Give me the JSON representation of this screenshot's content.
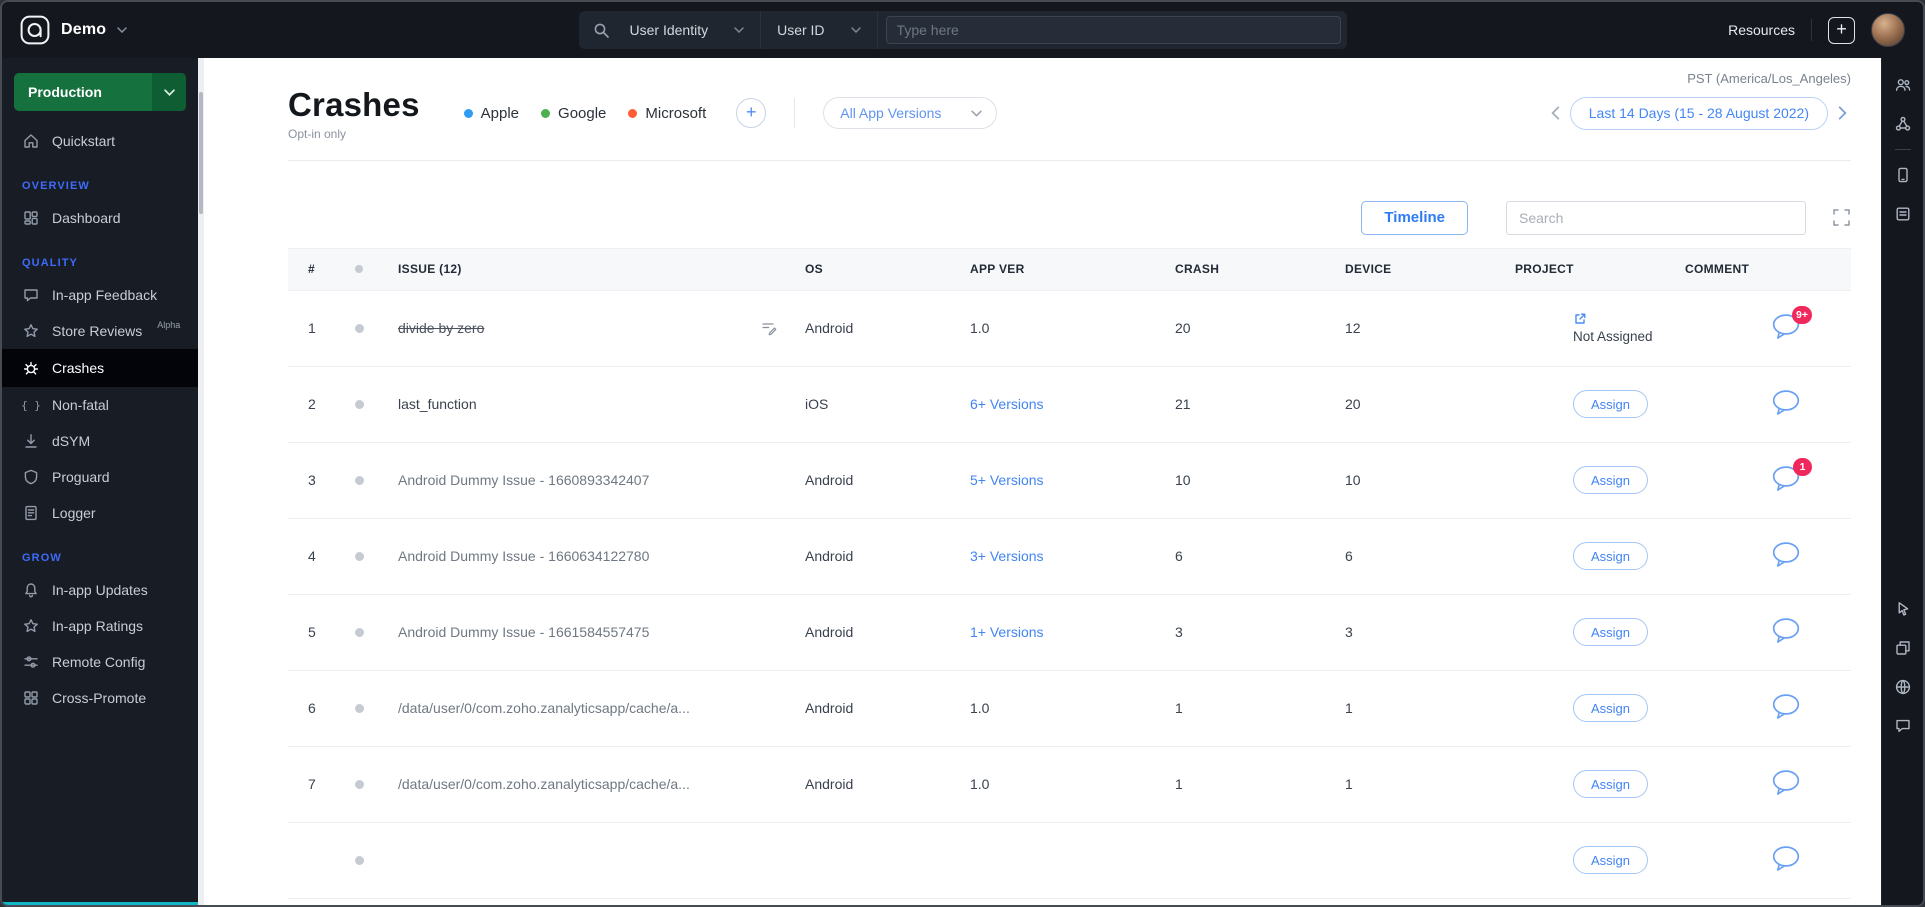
{
  "topbar": {
    "app_name": "Demo",
    "search": {
      "identity_label": "User Identity",
      "field_label": "User ID",
      "input_placeholder": "Type here"
    },
    "resources_label": "Resources"
  },
  "sidebar": {
    "environment": "Production",
    "items_top": [
      {
        "label": "Quickstart",
        "icon": "home-icon"
      }
    ],
    "sections": [
      {
        "title": "OVERVIEW",
        "items": [
          {
            "label": "Dashboard",
            "icon": "dashboard-icon"
          }
        ]
      },
      {
        "title": "QUALITY",
        "items": [
          {
            "label": "In-app Feedback",
            "icon": "feedback-icon"
          },
          {
            "label": "Store Reviews",
            "icon": "reviews-icon",
            "badge": "Alpha"
          },
          {
            "label": "Crashes",
            "icon": "crashes-icon",
            "active": true
          },
          {
            "label": "Non-fatal",
            "icon": "nonfatal-icon"
          },
          {
            "label": "dSYM",
            "icon": "dsym-icon"
          },
          {
            "label": "Proguard",
            "icon": "proguard-icon"
          },
          {
            "label": "Logger",
            "icon": "logger-icon"
          }
        ]
      },
      {
        "title": "GROW",
        "items": [
          {
            "label": "In-app Updates",
            "icon": "bell-icon"
          },
          {
            "label": "In-app Ratings",
            "icon": "ratings-icon"
          },
          {
            "label": "Remote Config",
            "icon": "remote-config-icon"
          },
          {
            "label": "Cross-Promote",
            "icon": "cross-promote-icon"
          }
        ]
      }
    ]
  },
  "right_rail": {
    "top_icons": [
      "team-icon",
      "integrations-icon"
    ],
    "middle_icons": [
      "device-icon",
      "docs-icon"
    ],
    "bottom_icons": [
      "pointer-icon",
      "windows-icon",
      "globe-icon",
      "chat-icon"
    ]
  },
  "header": {
    "timezone": "PST (America/Los_Angeles)",
    "title": "Crashes",
    "subtitle": "Opt-in only",
    "platforms": [
      {
        "label": "Apple",
        "color": "#2e9bf5"
      },
      {
        "label": "Google",
        "color": "#4caf50"
      },
      {
        "label": "Microsoft",
        "color": "#ff5c35"
      }
    ],
    "app_versions_label": "All App Versions",
    "date_range": "Last 14 Days (15 - 28 August 2022)"
  },
  "toolbar": {
    "timeline_label": "Timeline",
    "search_placeholder": "Search"
  },
  "table": {
    "headers": [
      "#",
      "ISSUE (12)",
      "OS",
      "APP VER",
      "CRASH",
      "DEVICE",
      "PROJECT",
      "COMMENT"
    ],
    "rows": [
      {
        "num": "1",
        "issue": "divide by zero",
        "strikethrough": true,
        "edit_icon": true,
        "os": "Android",
        "app_ver": "1.0",
        "app_ver_link": false,
        "crash": "20",
        "device": "12",
        "project": {
          "type": "not_assigned",
          "label": "Not Assigned"
        },
        "comment_badge": "9+"
      },
      {
        "num": "2",
        "issue": "last_function",
        "os": "iOS",
        "app_ver": "6+ Versions",
        "app_ver_link": true,
        "crash": "21",
        "device": "20",
        "project": {
          "type": "assign",
          "label": "Assign"
        },
        "comment_badge": null
      },
      {
        "num": "3",
        "issue": "Android Dummy Issue - 1660893342407",
        "muted": true,
        "os": "Android",
        "app_ver": "5+ Versions",
        "app_ver_link": true,
        "crash": "10",
        "device": "10",
        "project": {
          "type": "assign",
          "label": "Assign"
        },
        "comment_badge": "1"
      },
      {
        "num": "4",
        "issue": "Android Dummy Issue - 1660634122780",
        "muted": true,
        "os": "Android",
        "app_ver": "3+ Versions",
        "app_ver_link": true,
        "crash": "6",
        "device": "6",
        "project": {
          "type": "assign",
          "label": "Assign"
        },
        "comment_badge": null
      },
      {
        "num": "5",
        "issue": "Android Dummy Issue - 1661584557475",
        "muted": true,
        "os": "Android",
        "app_ver": "1+ Versions",
        "app_ver_link": true,
        "crash": "3",
        "device": "3",
        "project": {
          "type": "assign",
          "label": "Assign"
        },
        "comment_badge": null
      },
      {
        "num": "6",
        "issue": "/data/user/0/com.zoho.zanalyticsapp/cache/a...",
        "muted": true,
        "os": "Android",
        "app_ver": "1.0",
        "app_ver_link": false,
        "crash": "1",
        "device": "1",
        "project": {
          "type": "assign",
          "label": "Assign"
        },
        "comment_badge": null
      },
      {
        "num": "7",
        "issue": "/data/user/0/com.zoho.zanalyticsapp/cache/a...",
        "muted": true,
        "os": "Android",
        "app_ver": "1.0",
        "app_ver_link": false,
        "crash": "1",
        "device": "1",
        "project": {
          "type": "assign",
          "label": "Assign"
        },
        "comment_badge": null
      },
      {
        "num": "",
        "issue": "",
        "os": "",
        "app_ver": "",
        "app_ver_link": false,
        "crash": "",
        "device": "",
        "project": {
          "type": "assign",
          "label": "Assign"
        },
        "comment_badge": null,
        "partial": true
      }
    ]
  },
  "colors": {
    "accent_blue": "#4284f4",
    "section_label_blue": "#3e6bfb",
    "production_green": "#15713e",
    "badge_red": "#f0295c",
    "active_item_bg": "#02040a",
    "table_header_bg": "#f7f8fa",
    "sidebar_bottom_accent": "#11b7c4"
  }
}
